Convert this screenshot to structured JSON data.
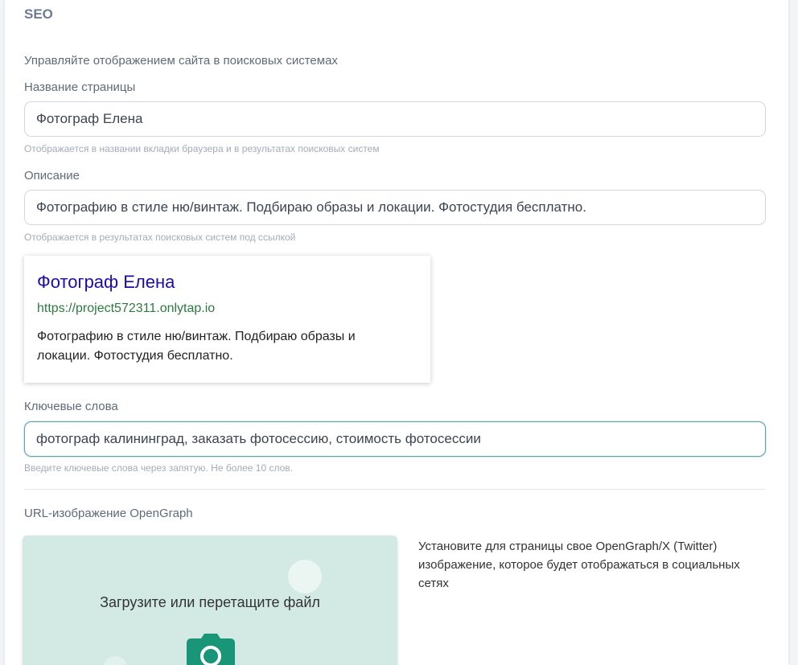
{
  "section": {
    "title": "SEO",
    "subtitle": "Управляйте отображением сайта в поисковых системах"
  },
  "page_name": {
    "label": "Название страницы",
    "value": "Фотограф Елена",
    "hint": "Отображается в названии вкладки браузера и в результатах поисковых систем"
  },
  "description": {
    "label": "Описание",
    "value": "Фотографию в стиле ню/винтаж. Подбираю образы и локации. Фотостудия бесплатно.",
    "hint": "Отображается в результатах поисковых систем под ссылкой"
  },
  "preview": {
    "title": "Фотограф Елена",
    "url": "https://project572311.onlytap.io",
    "description": "Фотографию в стиле ню/винтаж. Подбираю образы и локации. Фотостудия бесплатно."
  },
  "keywords": {
    "label": "Ключевые слова",
    "value": "фотограф калининград, заказать фотосессию, стоимость фотосессии",
    "hint": "Введите ключевые слова через запятую. Не более 10 слов."
  },
  "opengraph": {
    "label": "URL-изображение OpenGraph",
    "upload_text": "Загрузите или перетащите файл",
    "upload_icon": "camera-icon",
    "description": "Установите для страницы свое OpenGraph/X (Twitter) изображение, которое будет отображаться в социальных сетях"
  },
  "colors": {
    "accent": "#199577",
    "preview_title": "#1a0dab",
    "preview_url": "#2d7a3f",
    "upload_bg": "#d3eae4"
  }
}
